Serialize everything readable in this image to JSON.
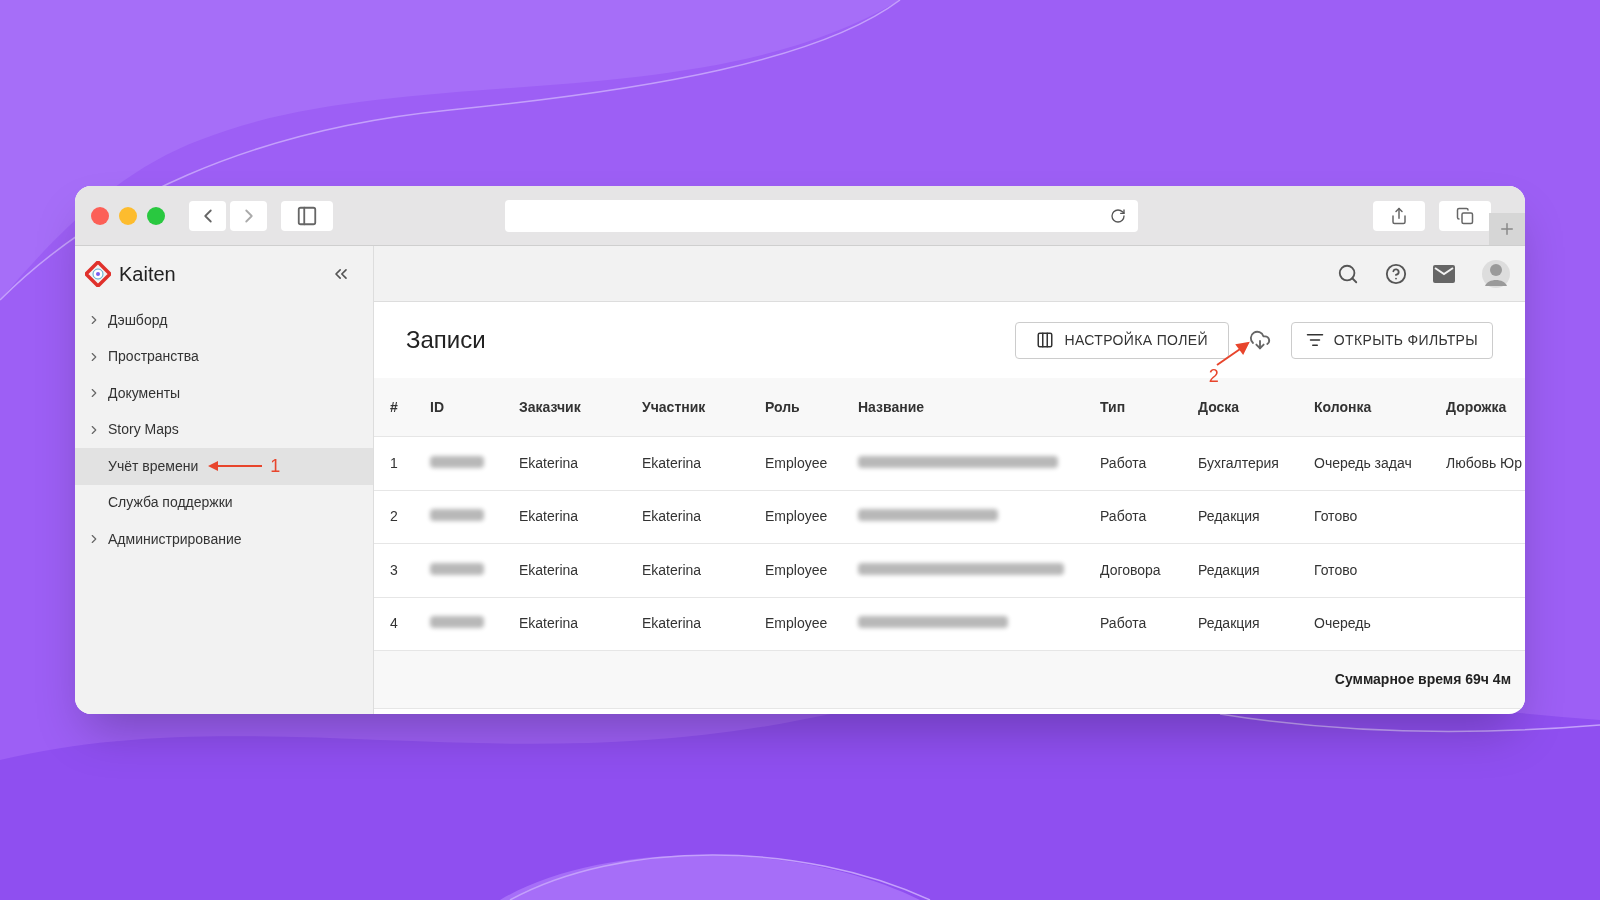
{
  "app": {
    "name": "Kaiten"
  },
  "sidebar": {
    "items": [
      {
        "label": "Дэшборд",
        "expandable": true,
        "selected": false
      },
      {
        "label": "Пространства",
        "expandable": true,
        "selected": false
      },
      {
        "label": "Документы",
        "expandable": true,
        "selected": false
      },
      {
        "label": "Story Maps",
        "expandable": true,
        "selected": false
      },
      {
        "label": "Учёт времени",
        "expandable": false,
        "selected": true
      },
      {
        "label": "Служба поддержки",
        "expandable": false,
        "selected": false
      },
      {
        "label": "Администрирование",
        "expandable": true,
        "selected": false
      }
    ]
  },
  "page": {
    "title": "Записи",
    "buttons": [
      "НАСТРОЙКА ПОЛЕЙ",
      "ОТКРЫТЬ ФИЛЬТРЫ"
    ]
  },
  "table": {
    "columns": [
      "#",
      "ID",
      "Заказчик",
      "Участник",
      "Роль",
      "Название",
      "Тип",
      "Доска",
      "Колонка",
      "Дорожка"
    ],
    "rows": [
      {
        "num": "1",
        "customer": "Ekaterina",
        "participant": "Ekaterina",
        "role": "Employee",
        "type": "Работа",
        "board": "Бухгалтерия",
        "column": "Очередь задач",
        "lane": "Любовь Юр"
      },
      {
        "num": "2",
        "customer": "Ekaterina",
        "participant": "Ekaterina",
        "role": "Employee",
        "type": "Работа",
        "board": "Редакция",
        "column": "Готово"
      },
      {
        "num": "3",
        "customer": "Ekaterina",
        "participant": "Ekaterina",
        "role": "Employee",
        "type": "Договора",
        "board": "Редакция",
        "column": "Готово"
      },
      {
        "num": "4",
        "customer": "Ekaterina",
        "participant": "Ekaterina",
        "role": "Employee",
        "type": "Работа",
        "board": "Редакция",
        "column": "Очередь"
      }
    ]
  },
  "footer": {
    "total": "Суммарное время 69ч 4м"
  },
  "annotations": [
    {
      "label": "1"
    },
    {
      "label": "2"
    }
  ]
}
